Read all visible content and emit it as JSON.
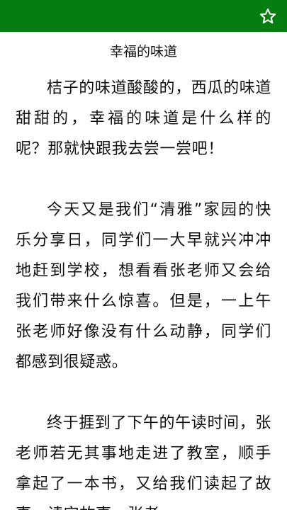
{
  "header": {
    "bg_color": "#057d10",
    "favorite_icon": "star-outline-icon"
  },
  "article": {
    "title": "幸福的味道",
    "paragraphs": [
      "桔子的味道酸酸的，西瓜的味道甜甜的，幸福的味道是什么样的呢？那就快跟我去尝一尝吧！",
      "今天又是我们“清雅”家园的快乐分享日，同学们一大早就兴冲冲地赶到学校，想看看张老师又会给我们带来什么惊喜。但是，一上午张老师好像没有什么动静，同学们都感到很疑惑。",
      "终于捱到了下午的午读时间，张老师若无其事地走进了教室，顺手拿起了一本书，又给我们读起了故事。读完故事，张老"
    ]
  }
}
